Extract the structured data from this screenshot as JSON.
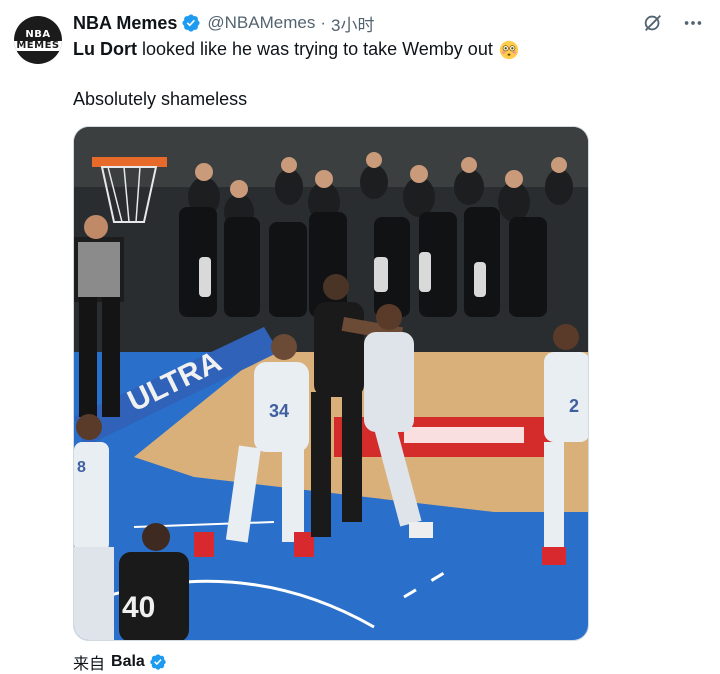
{
  "post": {
    "author_name": "NBA Memes",
    "author_handle": "@NBAMemes",
    "separator": "·",
    "timestamp": "3小时",
    "avatar_text_line1": "NBA",
    "avatar_text_line2": "MEMES",
    "text_bold": "Lu Dort",
    "text_rest": " looked like he was trying to take Wemby out",
    "text_line2": "Absolutely shameless",
    "media_banner_text": "ULTRA",
    "jersey_numbers": [
      "34",
      "40",
      "2",
      "8"
    ],
    "footer_prefix": "来自",
    "footer_user": "Bala"
  },
  "icons": {
    "verified": "verified-badge-icon",
    "grok": "grok-icon",
    "more": "more-icon",
    "emoji": "flushed-face-emoji"
  },
  "colors": {
    "verified_blue": "#1d9bf0",
    "secondary_text": "#536471",
    "court_blue": "#2a6fc9",
    "court_wood": "#d9b079"
  }
}
